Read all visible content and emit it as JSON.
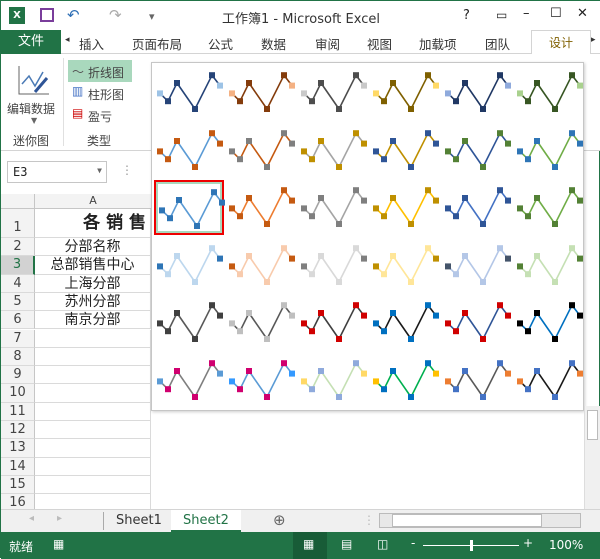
{
  "window": {
    "title": "工作簿1 - Microsoft Excel",
    "help": "?",
    "minimize": "–",
    "maximize": "☐",
    "close": "✕"
  },
  "quick_access": {
    "undo": "↶",
    "redo": "↷",
    "customize": "▾"
  },
  "tabs": {
    "file": "文件",
    "items": [
      "插入",
      "页面布局",
      "公式",
      "数据",
      "审阅",
      "视图",
      "加载项",
      "团队"
    ],
    "active": "设计"
  },
  "ribbon": {
    "edit_data": "编辑数据",
    "sparkline_group": "迷你图",
    "type_group": "类型",
    "types": [
      "折线图",
      "柱形图",
      "盈亏"
    ]
  },
  "namebox": "E3",
  "column_a": "A",
  "rows": [
    {
      "n": "1",
      "v": "各 销 售"
    },
    {
      "n": "2",
      "v": "分部名称"
    },
    {
      "n": "3",
      "v": "总部销售中心"
    },
    {
      "n": "4",
      "v": "上海分部"
    },
    {
      "n": "5",
      "v": "苏州分部"
    },
    {
      "n": "6",
      "v": "南京分部"
    },
    {
      "n": "7",
      "v": ""
    },
    {
      "n": "8",
      "v": ""
    },
    {
      "n": "9",
      "v": ""
    },
    {
      "n": "10",
      "v": ""
    },
    {
      "n": "11",
      "v": ""
    },
    {
      "n": "12",
      "v": ""
    },
    {
      "n": "13",
      "v": ""
    },
    {
      "n": "14",
      "v": ""
    },
    {
      "n": "15",
      "v": ""
    },
    {
      "n": "16",
      "v": ""
    }
  ],
  "sparkline_styles": [
    [
      {
        "line": "#264478",
        "m": "#264478",
        "e": "#9dc3e6"
      },
      {
        "line": "#843c0c",
        "m": "#843c0c",
        "e": "#f4b183"
      },
      {
        "line": "#4d4d4d",
        "m": "#4d4d4d",
        "e": "#c9c9c9"
      },
      {
        "line": "#7f6000",
        "m": "#7f6000",
        "e": "#ffd966"
      },
      {
        "line": "#203864",
        "m": "#203864",
        "e": "#8faadc"
      },
      {
        "line": "#375623",
        "m": "#375623",
        "e": "#a9d18e"
      }
    ],
    [
      {
        "line": "#5b9bd5",
        "m": "#c55a11",
        "e": "#c55a11"
      },
      {
        "line": "#c55a11",
        "m": "#7f7f7f",
        "e": "#7f7f7f"
      },
      {
        "line": "#a5a5a5",
        "m": "#bf9000",
        "e": "#bf9000"
      },
      {
        "line": "#bf9000",
        "m": "#2f5597",
        "e": "#2f5597"
      },
      {
        "line": "#2f5597",
        "m": "#538135",
        "e": "#538135"
      },
      {
        "line": "#70ad47",
        "m": "#2e75b6",
        "e": "#2e75b6"
      }
    ],
    [
      {
        "line": "#5b9bd5",
        "m": "#2e75b6",
        "e": "#2e75b6"
      },
      {
        "line": "#ed7d31",
        "m": "#c55a11",
        "e": "#c55a11"
      },
      {
        "line": "#a5a5a5",
        "m": "#7f7f7f",
        "e": "#7f7f7f"
      },
      {
        "line": "#ffc000",
        "m": "#bf9000",
        "e": "#bf9000"
      },
      {
        "line": "#4472c4",
        "m": "#2f5597",
        "e": "#2f5597"
      },
      {
        "line": "#70ad47",
        "m": "#538135",
        "e": "#538135"
      }
    ],
    [
      {
        "line": "#bdd7ee",
        "m": "#bdd7ee",
        "e": "#2e75b6"
      },
      {
        "line": "#f8cbad",
        "m": "#f8cbad",
        "e": "#c55a11"
      },
      {
        "line": "#d9d9d9",
        "m": "#d9d9d9",
        "e": "#7f7f7f"
      },
      {
        "line": "#ffe699",
        "m": "#ffe699",
        "e": "#bf9000"
      },
      {
        "line": "#b4c7e7",
        "m": "#b4c7e7",
        "e": "#44546a"
      },
      {
        "line": "#c5e0b4",
        "m": "#c5e0b4",
        "e": "#538135"
      }
    ],
    [
      {
        "line": "#595959",
        "m": "#404040",
        "e": "#404040"
      },
      {
        "line": "#595959",
        "m": "#bfbfbf",
        "e": "#bfbfbf"
      },
      {
        "line": "#404040",
        "m": "#d00000",
        "e": "#d00000"
      },
      {
        "line": "#1a1a1a",
        "m": "#0070c0",
        "e": "#0070c0"
      },
      {
        "line": "#2f5597",
        "m": "#d00000",
        "e": "#d00000"
      },
      {
        "line": "#0070c0",
        "m": "#000000",
        "e": "#000000"
      }
    ],
    [
      {
        "line": "#7f7f7f",
        "m": "#d0006f",
        "e": "#5b9bd5"
      },
      {
        "line": "#5b9bd5",
        "m": "#d0006f",
        "e": "#3399ff"
      },
      {
        "line": "#c5e0b4",
        "m": "#8faadc",
        "e": "#ffd966"
      },
      {
        "line": "#00b050",
        "m": "#0070c0",
        "e": "#ffc000"
      },
      {
        "line": "#595959",
        "m": "#4472c4",
        "e": "#ed7d31"
      },
      {
        "line": "#1a1a1a",
        "m": "#4472c4",
        "e": "#ed7d31"
      }
    ]
  ],
  "sparkline_values": [
    3,
    1.5,
    5,
    0,
    6.5,
    4.5
  ],
  "sheets": [
    "Sheet1",
    "Sheet2"
  ],
  "active_sheet": "Sheet2",
  "status": {
    "ready": "就绪",
    "zoom": "100%",
    "zoom_level": 100
  }
}
